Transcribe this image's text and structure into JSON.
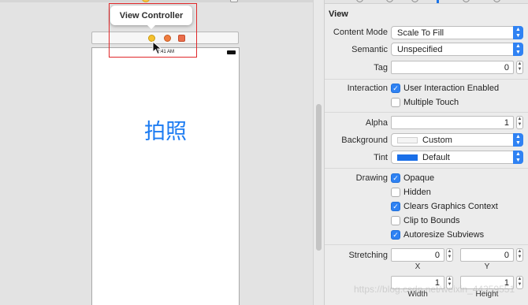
{
  "canvas": {
    "tooltip": "View Controller",
    "status_time": "9:41 AM",
    "photo_label": "拍照"
  },
  "inspector": {
    "section_title": "View",
    "content_mode": {
      "label": "Content Mode",
      "value": "Scale To Fill"
    },
    "semantic": {
      "label": "Semantic",
      "value": "Unspecified"
    },
    "tag": {
      "label": "Tag",
      "value": "0"
    },
    "interaction": {
      "label": "Interaction",
      "options": [
        {
          "label": "User Interaction Enabled",
          "checked": true
        },
        {
          "label": "Multiple Touch",
          "checked": false
        }
      ]
    },
    "alpha": {
      "label": "Alpha",
      "value": "1"
    },
    "background": {
      "label": "Background",
      "value": "Custom",
      "swatch_color": "#f4f4f4"
    },
    "tint": {
      "label": "Tint",
      "value": "Default",
      "swatch_color": "#1a6fe8"
    },
    "drawing": {
      "label": "Drawing",
      "options": [
        {
          "label": "Opaque",
          "checked": true
        },
        {
          "label": "Hidden",
          "checked": false
        },
        {
          "label": "Clears Graphics Context",
          "checked": true
        },
        {
          "label": "Clip to Bounds",
          "checked": false
        },
        {
          "label": "Autoresize Subviews",
          "checked": true
        }
      ]
    },
    "stretching": {
      "label": "Stretching",
      "x": {
        "value": "0",
        "sublabel": "X"
      },
      "y": {
        "value": "0",
        "sublabel": "Y"
      },
      "width": {
        "value": "1",
        "sublabel": "Width"
      },
      "height": {
        "value": "1",
        "sublabel": "Height"
      }
    }
  },
  "watermark": "https://blog.csdn.net/weixin_44359551",
  "colors": {
    "accent": "#2f82f3",
    "label_blue": "#1d7cf2",
    "highlight_red": "#e0282a"
  }
}
